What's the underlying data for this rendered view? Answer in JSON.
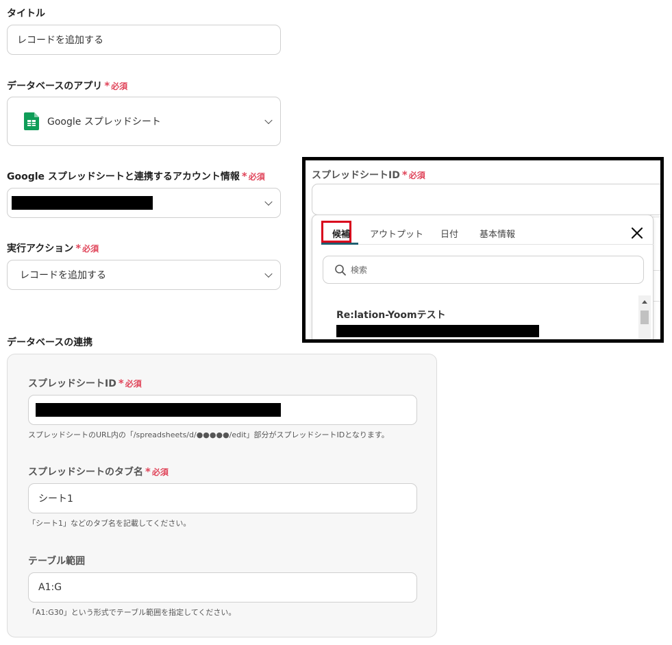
{
  "required_label": "必須",
  "title_field": {
    "label": "タイトル",
    "value": "レコードを追加する"
  },
  "db_app": {
    "label": "データベースのアプリ",
    "value": "Google スプレッドシート"
  },
  "account": {
    "label": "Google スプレッドシートと連携するアカウント情報"
  },
  "action": {
    "label": "実行アクション",
    "value": "レコードを追加する"
  },
  "db_link": {
    "section_title": "データベースの連携",
    "sheet_id": {
      "label": "スプレッドシートID",
      "help": "スプレッドシートのURL内の「/spreadsheets/d/●●●●●/edit」部分がスプレッドシートIDとなります。"
    },
    "tab_name": {
      "label": "スプレッドシートのタブ名",
      "value": "シート1",
      "help": "「シート1」などのタブ名を記載してください。"
    },
    "table_range": {
      "label": "テーブル範囲",
      "value": "A1:G",
      "help": "「A1:G30」という形式でテーブル範囲を指定してください。"
    }
  },
  "popup": {
    "label": "スプレッドシートID",
    "tabs": [
      "候補",
      "アウトプット",
      "日付",
      "基本情報"
    ],
    "search_placeholder": "検索",
    "suggestion_title": "Re:lation-Yoomテスト"
  },
  "colors": {
    "required": "#e0455a",
    "highlight": "#d8001c",
    "tab_underline": "#1f5f70"
  }
}
